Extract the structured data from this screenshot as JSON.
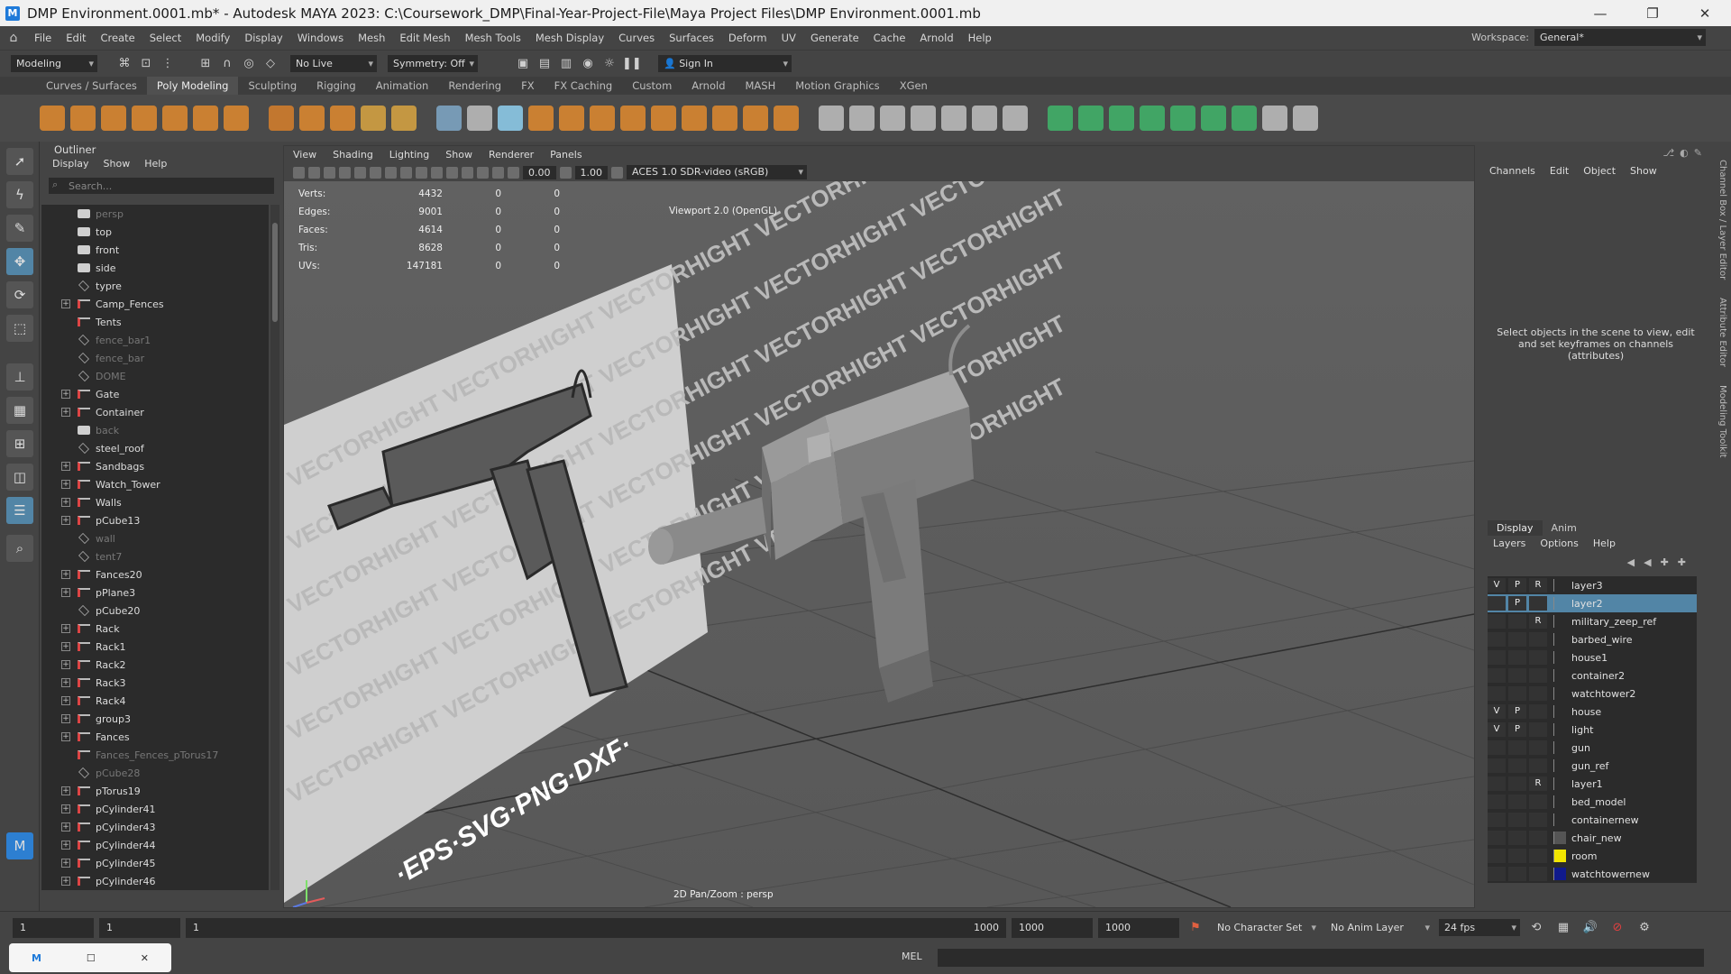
{
  "window": {
    "title": "DMP Environment.0001.mb* - Autodesk MAYA 2023: C:\\Coursework_DMP\\Final-Year-Project-File\\Maya Project Files\\DMP Environment.0001.mb",
    "minimize": "—",
    "restore": "❐",
    "close": "✕"
  },
  "menubar": {
    "items": [
      "File",
      "Edit",
      "Create",
      "Select",
      "Modify",
      "Display",
      "Windows",
      "Mesh",
      "Edit Mesh",
      "Mesh Tools",
      "Mesh Display",
      "Curves",
      "Surfaces",
      "Deform",
      "UV",
      "Generate",
      "Cache",
      "Arnold",
      "Help"
    ],
    "workspace_label": "Workspace:",
    "workspace_value": "General*"
  },
  "statusline": {
    "mode": "Modeling",
    "live_surface": "No Live Surface",
    "symmetry": "Symmetry: Off",
    "sign_in": "Sign In"
  },
  "shelf_tabs": [
    "Curves / Surfaces",
    "Poly Modeling",
    "Sculpting",
    "Rigging",
    "Animation",
    "Rendering",
    "FX",
    "FX Caching",
    "Custom",
    "Arnold",
    "MASH",
    "Motion Graphics",
    "XGen"
  ],
  "shelf_active_tab": "Poly Modeling",
  "outliner": {
    "title": "Outliner",
    "menu": [
      "Display",
      "Show",
      "Help"
    ],
    "search_placeholder": "Search...",
    "items": [
      {
        "label": "persp",
        "kind": "cam",
        "exp": false,
        "dim": true
      },
      {
        "label": "top",
        "kind": "cam",
        "exp": false,
        "dim": false
      },
      {
        "label": "front",
        "kind": "cam",
        "exp": false,
        "dim": false
      },
      {
        "label": "side",
        "kind": "cam",
        "exp": false,
        "dim": false
      },
      {
        "label": "typre",
        "kind": "mesh",
        "exp": false,
        "dim": false
      },
      {
        "label": "Camp_Fences",
        "kind": "group",
        "exp": true,
        "dim": false
      },
      {
        "label": "Tents",
        "kind": "group",
        "exp": false,
        "dim": false
      },
      {
        "label": "fence_bar1",
        "kind": "mesh",
        "exp": false,
        "dim": true
      },
      {
        "label": "fence_bar",
        "kind": "mesh",
        "exp": false,
        "dim": true
      },
      {
        "label": "DOME",
        "kind": "mesh",
        "exp": false,
        "dim": true
      },
      {
        "label": "Gate",
        "kind": "group",
        "exp": true,
        "dim": false
      },
      {
        "label": "Container",
        "kind": "group",
        "exp": true,
        "dim": false
      },
      {
        "label": "back",
        "kind": "cam",
        "exp": false,
        "dim": true
      },
      {
        "label": "steel_roof",
        "kind": "mesh",
        "exp": false,
        "dim": false
      },
      {
        "label": "Sandbags",
        "kind": "group",
        "exp": true,
        "dim": false
      },
      {
        "label": "Watch_Tower",
        "kind": "group",
        "exp": true,
        "dim": false
      },
      {
        "label": "Walls",
        "kind": "group",
        "exp": true,
        "dim": false
      },
      {
        "label": "pCube13",
        "kind": "group",
        "exp": true,
        "dim": false
      },
      {
        "label": "wall",
        "kind": "mesh",
        "exp": false,
        "dim": true
      },
      {
        "label": "tent7",
        "kind": "mesh",
        "exp": false,
        "dim": true
      },
      {
        "label": "Fances20",
        "kind": "group",
        "exp": true,
        "dim": false
      },
      {
        "label": "pPlane3",
        "kind": "group",
        "exp": true,
        "dim": false
      },
      {
        "label": "pCube20",
        "kind": "mesh",
        "exp": false,
        "dim": false
      },
      {
        "label": "Rack",
        "kind": "group",
        "exp": true,
        "dim": false
      },
      {
        "label": "Rack1",
        "kind": "group",
        "exp": true,
        "dim": false
      },
      {
        "label": "Rack2",
        "kind": "group",
        "exp": true,
        "dim": false
      },
      {
        "label": "Rack3",
        "kind": "group",
        "exp": true,
        "dim": false
      },
      {
        "label": "Rack4",
        "kind": "group",
        "exp": true,
        "dim": false
      },
      {
        "label": "group3",
        "kind": "group",
        "exp": true,
        "dim": false
      },
      {
        "label": "Fances",
        "kind": "group",
        "exp": true,
        "dim": false
      },
      {
        "label": "Fances_Fences_pTorus17",
        "kind": "group",
        "exp": false,
        "dim": true
      },
      {
        "label": "pCube28",
        "kind": "mesh",
        "exp": false,
        "dim": true
      },
      {
        "label": "pTorus19",
        "kind": "group",
        "exp": true,
        "dim": false
      },
      {
        "label": "pCylinder41",
        "kind": "group",
        "exp": true,
        "dim": false
      },
      {
        "label": "pCylinder43",
        "kind": "group",
        "exp": true,
        "dim": false
      },
      {
        "label": "pCylinder44",
        "kind": "group",
        "exp": true,
        "dim": false
      },
      {
        "label": "pCylinder45",
        "kind": "group",
        "exp": true,
        "dim": false
      },
      {
        "label": "pCylinder46",
        "kind": "group",
        "exp": true,
        "dim": false
      }
    ]
  },
  "viewport": {
    "menu": [
      "View",
      "Shading",
      "Lighting",
      "Show",
      "Renderer",
      "Panels"
    ],
    "near_value": "0.00",
    "far_value": "1.00",
    "color_space": "ACES 1.0 SDR-video (sRGB)",
    "renderer_label": "Viewport 2.0 (OpenGL)",
    "camera_label": "2D Pan/Zoom : persp",
    "stats": [
      {
        "label": "Verts:",
        "v": "4432",
        "a": "0",
        "b": "0"
      },
      {
        "label": "Edges:",
        "v": "9001",
        "a": "0",
        "b": "0"
      },
      {
        "label": "Faces:",
        "v": "4614",
        "a": "0",
        "b": "0"
      },
      {
        "label": "Tris:",
        "v": "8628",
        "a": "0",
        "b": "0"
      },
      {
        "label": "UVs:",
        "v": "147181",
        "a": "0",
        "b": "0"
      }
    ],
    "image_plane_banner": "·EPS·SVG·PNG·DXF·",
    "image_plane_watermark": "VECTORHIGHT"
  },
  "channelbox": {
    "menu": [
      "Channels",
      "Edit",
      "Object",
      "Show"
    ],
    "message": "Select objects in the scene to view, edit and set keyframes on channels (attributes)",
    "side_tabs": [
      "Channel Box / Layer Editor",
      "Attribute Editor",
      "Modeling Toolkit"
    ]
  },
  "layer_editor": {
    "tabs": [
      "Display",
      "Anim"
    ],
    "menu": [
      "Layers",
      "Options",
      "Help"
    ],
    "layers": [
      {
        "name": "layer3",
        "v": "V",
        "p": "P",
        "r": "R",
        "color": "",
        "selected": false
      },
      {
        "name": "layer2",
        "v": "",
        "p": "P",
        "r": "",
        "color": "",
        "selected": true
      },
      {
        "name": "military_zeep_ref",
        "v": "",
        "p": "",
        "r": "R",
        "color": "",
        "selected": false
      },
      {
        "name": "barbed_wire",
        "v": "",
        "p": "",
        "r": "",
        "color": "",
        "selected": false
      },
      {
        "name": "house1",
        "v": "",
        "p": "",
        "r": "",
        "color": "",
        "selected": false
      },
      {
        "name": "container2",
        "v": "",
        "p": "",
        "r": "",
        "color": "",
        "selected": false
      },
      {
        "name": "watchtower2",
        "v": "",
        "p": "",
        "r": "",
        "color": "",
        "selected": false
      },
      {
        "name": "house",
        "v": "V",
        "p": "P",
        "r": "",
        "color": "",
        "selected": false
      },
      {
        "name": "light",
        "v": "V",
        "p": "P",
        "r": "",
        "color": "",
        "selected": false
      },
      {
        "name": "gun",
        "v": "",
        "p": "",
        "r": "",
        "color": "",
        "selected": false
      },
      {
        "name": "gun_ref",
        "v": "",
        "p": "",
        "r": "",
        "color": "",
        "selected": false
      },
      {
        "name": "layer1",
        "v": "",
        "p": "",
        "r": "R",
        "color": "",
        "selected": false
      },
      {
        "name": "bed_model",
        "v": "",
        "p": "",
        "r": "",
        "color": "",
        "selected": false
      },
      {
        "name": "containernew",
        "v": "",
        "p": "",
        "r": "",
        "color": "",
        "selected": false
      },
      {
        "name": "chair_new",
        "v": "",
        "p": "",
        "r": "",
        "color": "#555555",
        "selected": false
      },
      {
        "name": "room",
        "v": "",
        "p": "",
        "r": "",
        "color": "#f2e600",
        "selected": false
      },
      {
        "name": "watchtowernew",
        "v": "",
        "p": "",
        "r": "",
        "color": "#101a8c",
        "selected": false
      }
    ]
  },
  "timeline": {
    "start": "1",
    "current": "1",
    "range_start": "1",
    "range_end": "1000",
    "end1": "1000",
    "end2": "1000",
    "character_set": "No Character Set",
    "anim_layer": "No Anim Layer",
    "fps": "24 fps"
  },
  "command_line": {
    "language": "MEL"
  },
  "colors": {
    "selection": "#5285a6",
    "panel": "#444444",
    "field": "#2b2b2b"
  }
}
